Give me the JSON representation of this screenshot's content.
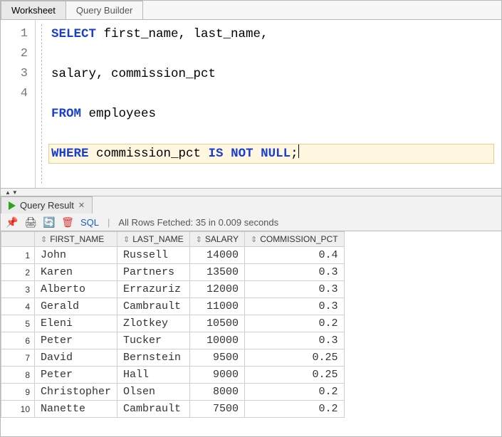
{
  "tabs": {
    "worksheet": "Worksheet",
    "query_builder": "Query Builder"
  },
  "editor": {
    "lines": [
      {
        "no": "1",
        "segments": [
          {
            "t": "SELECT",
            "kw": true
          },
          {
            "t": " first_name, last_name,"
          }
        ]
      },
      {
        "no": "2",
        "segments": [
          {
            "t": "salary, commission_pct"
          }
        ]
      },
      {
        "no": "3",
        "segments": [
          {
            "t": "FROM",
            "kw": true
          },
          {
            "t": " employees"
          }
        ]
      },
      {
        "no": "4",
        "segments": [
          {
            "t": "WHERE",
            "kw": true
          },
          {
            "t": " commission_pct "
          },
          {
            "t": "IS",
            "kw": true
          },
          {
            "t": " "
          },
          {
            "t": "NOT",
            "kw": true
          },
          {
            "t": " "
          },
          {
            "t": "NULL",
            "kw": true
          },
          {
            "t": ";"
          }
        ],
        "highlight": true,
        "cursor_after": true
      }
    ]
  },
  "splitter_glyph": "▲▼",
  "result_tab_label": "Query Result",
  "toolbar": {
    "sql_label": "SQL",
    "status": "All Rows Fetched: 35 in 0.009 seconds"
  },
  "grid": {
    "columns": [
      "FIRST_NAME",
      "LAST_NAME",
      "SALARY",
      "COMMISSION_PCT"
    ],
    "numeric_cols": [
      false,
      false,
      true,
      true
    ],
    "rows": [
      {
        "n": "1",
        "c": [
          "John",
          "Russell",
          "14000",
          "0.4"
        ]
      },
      {
        "n": "2",
        "c": [
          "Karen",
          "Partners",
          "13500",
          "0.3"
        ]
      },
      {
        "n": "3",
        "c": [
          "Alberto",
          "Errazuriz",
          "12000",
          "0.3"
        ]
      },
      {
        "n": "4",
        "c": [
          "Gerald",
          "Cambrault",
          "11000",
          "0.3"
        ]
      },
      {
        "n": "5",
        "c": [
          "Eleni",
          "Zlotkey",
          "10500",
          "0.2"
        ]
      },
      {
        "n": "6",
        "c": [
          "Peter",
          "Tucker",
          "10000",
          "0.3"
        ]
      },
      {
        "n": "7",
        "c": [
          "David",
          "Bernstein",
          "9500",
          "0.25"
        ]
      },
      {
        "n": "8",
        "c": [
          "Peter",
          "Hall",
          "9000",
          "0.25"
        ]
      },
      {
        "n": "9",
        "c": [
          "Christopher",
          "Olsen",
          "8000",
          "0.2"
        ]
      },
      {
        "n": "10",
        "c": [
          "Nanette",
          "Cambrault",
          "7500",
          "0.2"
        ]
      }
    ]
  }
}
